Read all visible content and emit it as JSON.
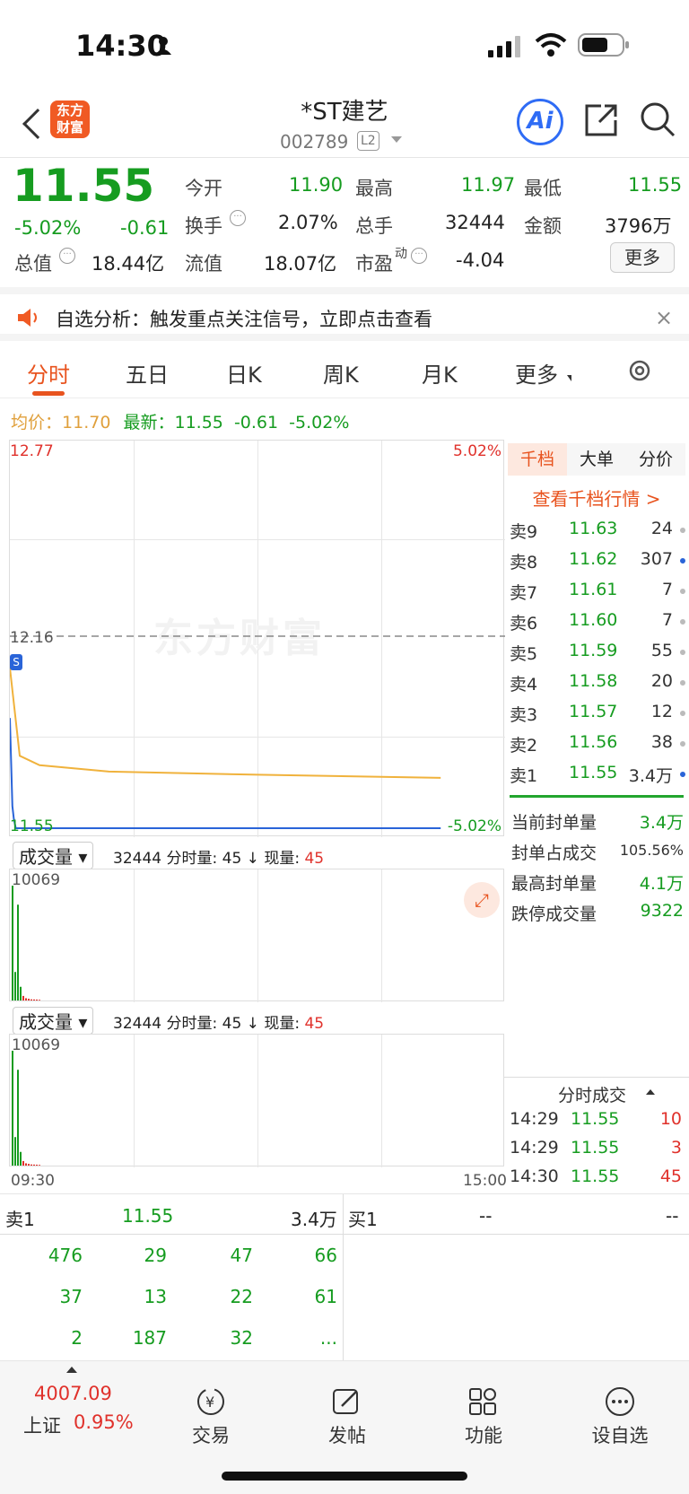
{
  "status": {
    "time": "14:30"
  },
  "nav": {
    "title": "*ST建艺",
    "code": "002789",
    "level": "L2",
    "logo_text": "东方财富",
    "ai_label": "Ai"
  },
  "quote": {
    "price": "11.55",
    "change_pct": "-5.02%",
    "change": "-0.61",
    "open_label": "今开",
    "open": "11.90",
    "high_label": "最高",
    "high": "11.97",
    "low_label": "最低",
    "low": "11.55",
    "turnover_label": "换手",
    "turnover": "2.07%",
    "volume_label": "总手",
    "volume": "32444",
    "amount_label": "金额",
    "amount": "3796万",
    "mktcap_label": "总值",
    "mktcap": "18.44亿",
    "float_label": "流值",
    "float": "18.07亿",
    "pe_label": "市盈",
    "pe_sup": "动",
    "pe": "-4.04",
    "more": "更多"
  },
  "notice": {
    "text": "自选分析：触发重点关注信号，立即点击查看"
  },
  "tabs": [
    "分时",
    "五日",
    "日K",
    "周K",
    "月K",
    "更多"
  ],
  "chart_info": {
    "avg_label": "均价：",
    "avg": "11.70",
    "latest_label": "最新：",
    "latest": "11.55",
    "latest_chg": "-0.61",
    "latest_pct": "-5.02%"
  },
  "chart_data": {
    "type": "line",
    "ylim": [
      11.55,
      12.77
    ],
    "ref": 12.16,
    "y_top": "12.77",
    "y_mid": "12.16",
    "y_bottom": "11.55",
    "pct_top": "5.02%",
    "pct_bottom": "-5.02%",
    "x_start": "09:30",
    "x_end": "15:00",
    "watermark": "东方财富",
    "series": [
      {
        "name": "均价",
        "color": "#f0b23c",
        "points": [
          [
            0,
            12.06
          ],
          [
            0.02,
            11.78
          ],
          [
            0.06,
            11.75
          ],
          [
            0.2,
            11.73
          ],
          [
            0.5,
            11.72
          ],
          [
            0.87,
            11.71
          ]
        ]
      },
      {
        "name": "最新",
        "color": "#2a64d8",
        "points": [
          [
            0,
            11.9
          ],
          [
            0.005,
            11.62
          ],
          [
            0.008,
            11.58
          ],
          [
            0.012,
            11.55
          ],
          [
            0.87,
            11.55
          ]
        ]
      }
    ]
  },
  "volume_panel": {
    "selector": "成交量",
    "total": "32444",
    "mins_label": "分时量:",
    "mins": "45",
    "now_label": "现量:",
    "now": "45",
    "max": "10069",
    "bars": [
      10069,
      2500,
      8400,
      1200,
      400,
      200,
      150,
      100,
      90,
      80,
      60
    ]
  },
  "order_tabs": [
    "千档",
    "大单",
    "分价"
  ],
  "order_link": "查看千档行情 >",
  "asks": [
    {
      "label": "卖9",
      "price": "11.63",
      "vol": "24",
      "dot": "#bbb"
    },
    {
      "label": "卖8",
      "price": "11.62",
      "vol": "307",
      "dot": "#2a64d8"
    },
    {
      "label": "卖7",
      "price": "11.61",
      "vol": "7",
      "dot": "#bbb"
    },
    {
      "label": "卖6",
      "price": "11.60",
      "vol": "7",
      "dot": "#bbb"
    },
    {
      "label": "卖5",
      "price": "11.59",
      "vol": "55",
      "dot": "#bbb"
    },
    {
      "label": "卖4",
      "price": "11.58",
      "vol": "20",
      "dot": "#bbb"
    },
    {
      "label": "卖3",
      "price": "11.57",
      "vol": "12",
      "dot": "#bbb"
    },
    {
      "label": "卖2",
      "price": "11.56",
      "vol": "38",
      "dot": "#bbb"
    },
    {
      "label": "卖1",
      "price": "11.55",
      "vol": "3.4万",
      "dot": "#2a64d8"
    }
  ],
  "seal_stats": [
    {
      "label": "当前封单量",
      "value": "3.4万"
    },
    {
      "label": "封单占成交",
      "value": "105.56%"
    },
    {
      "label": "最高封单量",
      "value": "4.1万"
    },
    {
      "label": "跌停成交量",
      "value": "9322"
    }
  ],
  "ticks_title": "分时成交",
  "ticks": [
    {
      "time": "14:29",
      "price": "11.55",
      "vol": "10"
    },
    {
      "time": "14:29",
      "price": "11.55",
      "vol": "3"
    },
    {
      "time": "14:30",
      "price": "11.55",
      "vol": "45"
    }
  ],
  "bottom_book": {
    "sell_label": "卖1",
    "sell_price": "11.55",
    "sell_vol": "3.4万",
    "buy_label": "买1",
    "buy_price": "--",
    "buy_vol": "--",
    "queue": [
      [
        "476",
        "29",
        "47",
        "66"
      ],
      [
        "37",
        "13",
        "22",
        "61"
      ],
      [
        "2",
        "187",
        "32",
        "..."
      ]
    ]
  },
  "tabbar": {
    "index_value": "4007.09",
    "index_name": "上证",
    "index_pct": "0.95%",
    "items": [
      "交易",
      "发帖",
      "功能",
      "设自选"
    ]
  }
}
